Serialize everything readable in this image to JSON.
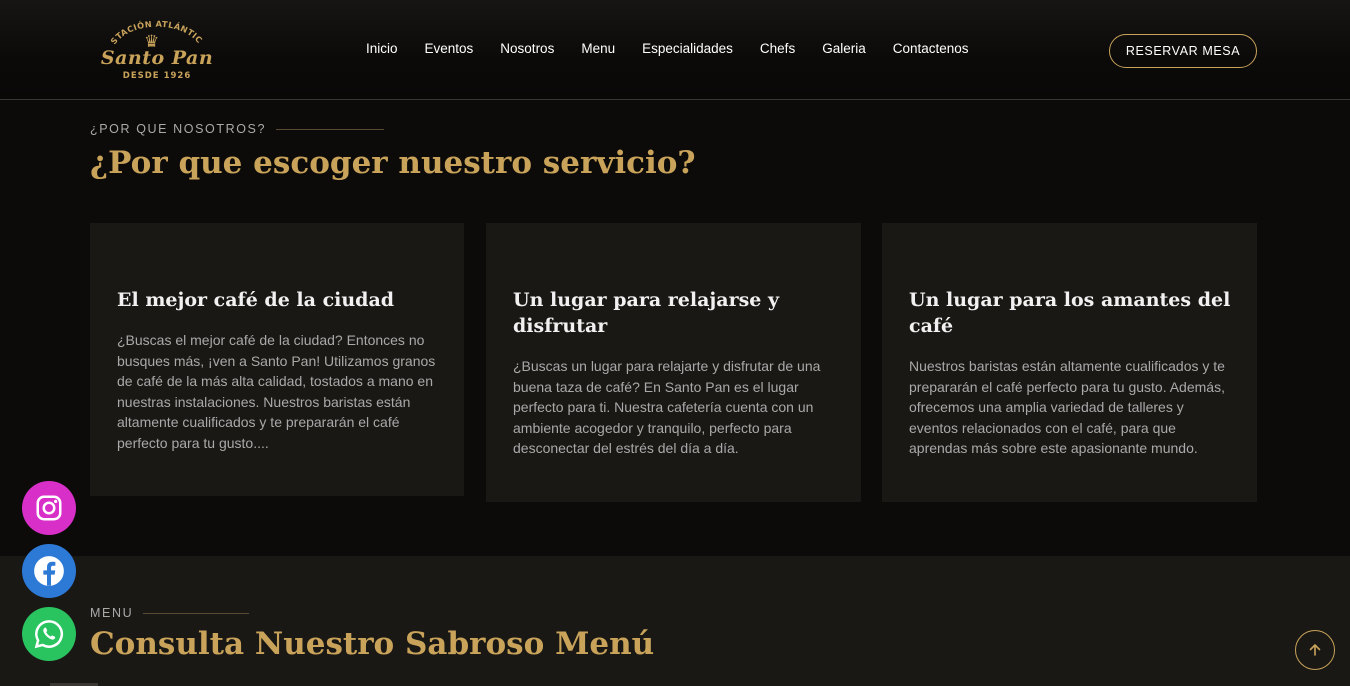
{
  "header": {
    "logo": {
      "arc_text": "ESTACIÓN ATLÁNTICO",
      "brand": "Santo Pan",
      "since": "DESDE 1926"
    },
    "nav": [
      "Inicio",
      "Eventos",
      "Nosotros",
      "Menu",
      "Especialidades",
      "Chefs",
      "Galeria",
      "Contactenos"
    ],
    "reserve_label": "RESERVAR MESA"
  },
  "why": {
    "tag": "¿POR QUE NOSOTROS?",
    "title": "¿Por que escoger nuestro servicio?",
    "cards": [
      {
        "title": "El mejor café de la ciudad",
        "text": "¿Buscas el mejor café de la ciudad? Entonces no busques más, ¡ven a Santo Pan! Utilizamos granos de café de la más alta calidad, tostados a mano en nuestras instalaciones. Nuestros baristas están altamente cualificados y te prepararán el café perfecto para tu gusto...."
      },
      {
        "title": "Un lugar para relajarse y disfrutar",
        "text": "¿Buscas un lugar para relajarte y disfrutar de una buena taza de café? En Santo Pan es el lugar perfecto para ti. Nuestra cafetería cuenta con un ambiente acogedor y tranquilo, perfecto para desconectar del estrés del día a día."
      },
      {
        "title": "Un lugar para los amantes del café",
        "text": "Nuestros baristas están altamente cualificados y te prepararán el café perfecto para tu gusto. Además, ofrecemos una amplia variedad de talleres y eventos relacionados con el café, para que aprendas más sobre este apasionante mundo."
      }
    ]
  },
  "menu": {
    "tag": "MENU",
    "title": "Consulta Nuestro Sabroso Menú"
  },
  "social": {
    "instagram_icon": "instagram-icon",
    "facebook_icon": "facebook-icon",
    "whatsapp_icon": "whatsapp-icon"
  },
  "colors": {
    "accent": "#c9a35a",
    "background": "#0c0b09",
    "card": "#1a1815",
    "instagram": "#d82fc9",
    "facebook": "#2c79d6",
    "whatsapp": "#29c460"
  }
}
